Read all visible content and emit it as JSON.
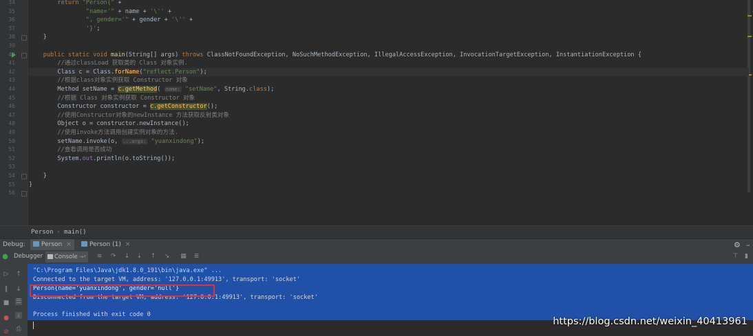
{
  "editor": {
    "lines": [
      {
        "no": "34",
        "html_tokens": [
          [
            "kw",
            "        return "
          ],
          [
            "str",
            "\"Person{\""
          ],
          [
            "cls",
            " +"
          ]
        ]
      },
      {
        "no": "35",
        "html_tokens": [
          [
            "str",
            "                \"name='\""
          ],
          [
            "cls",
            " + name + "
          ],
          [
            "str",
            "'\\''"
          ],
          [
            "cls",
            " +"
          ]
        ]
      },
      {
        "no": "36",
        "html_tokens": [
          [
            "str",
            "                \", gender='\""
          ],
          [
            "cls",
            " + gender + "
          ],
          [
            "str",
            "'\\''"
          ],
          [
            "cls",
            " +"
          ]
        ]
      },
      {
        "no": "37",
        "html_tokens": [
          [
            "str",
            "                '}'"
          ],
          [
            "cls",
            ";"
          ]
        ]
      },
      {
        "no": "38",
        "html_tokens": [
          [
            "cls",
            "    }"
          ]
        ]
      },
      {
        "no": "39",
        "html_tokens": []
      },
      {
        "no": "40",
        "html_tokens": [
          [
            "kw",
            "    public static void "
          ],
          [
            "fn",
            "main"
          ],
          [
            "cls",
            "(String[] args) "
          ],
          [
            "kw",
            "throws "
          ],
          [
            "cls",
            "ClassNotFoundException, NoSuchMethodException, IllegalAccessException, InvocationTargetException, InstantiationException {"
          ]
        ]
      },
      {
        "no": "41",
        "html_tokens": [
          [
            "cm",
            "        //通过classLoad 获取类的 Class 对象实例."
          ]
        ]
      },
      {
        "no": "42",
        "html_tokens": [
          [
            "cls",
            "        Class c = Class."
          ],
          [
            "fn",
            "forName"
          ],
          [
            "cls",
            "("
          ],
          [
            "str",
            "\"reflect.Person\""
          ],
          [
            "cls",
            ");"
          ]
        ]
      },
      {
        "no": "43",
        "html_tokens": [
          [
            "cm",
            "        //根据class对象实例获取 Constructor 对象"
          ]
        ]
      },
      {
        "no": "44",
        "html_tokens": [
          [
            "cls",
            "        Method setName = "
          ],
          [
            "sel",
            "c.getMethod"
          ],
          [
            "cls",
            "( "
          ],
          [
            "hint",
            "name:"
          ],
          [
            "str",
            " \"setName\""
          ],
          [
            "cls",
            ", String."
          ],
          [
            "kw",
            "class"
          ],
          [
            "cls",
            ");"
          ]
        ]
      },
      {
        "no": "45",
        "html_tokens": [
          [
            "cm",
            "        //根据 Class 对象实例获取 Constructor 对象"
          ]
        ]
      },
      {
        "no": "46",
        "html_tokens": [
          [
            "cls",
            "        Constructor constructor = "
          ],
          [
            "sel",
            "c.getConstructor"
          ],
          [
            "cls",
            "();"
          ]
        ]
      },
      {
        "no": "47",
        "html_tokens": [
          [
            "cm",
            "        //使用Constructor对象的newInstance 方法获取反射类对象"
          ]
        ]
      },
      {
        "no": "48",
        "html_tokens": [
          [
            "cls",
            "        Object o = constructor.newInstance();"
          ]
        ]
      },
      {
        "no": "49",
        "html_tokens": [
          [
            "cm",
            "        //使用invoke方法调用创建实例对象的方法."
          ]
        ]
      },
      {
        "no": "50",
        "html_tokens": [
          [
            "cls",
            "        setName.invoke(o, "
          ],
          [
            "hint",
            "...args:"
          ],
          [
            "str",
            " \"yuanxindong\""
          ],
          [
            "cls",
            ");"
          ]
        ]
      },
      {
        "no": "51",
        "html_tokens": [
          [
            "cm",
            "        //查看调用是否成功"
          ]
        ]
      },
      {
        "no": "52",
        "html_tokens": [
          [
            "cls",
            "        System."
          ],
          [
            "fld",
            "out"
          ],
          [
            "cls",
            ".println(o.toString());"
          ]
        ]
      },
      {
        "no": "53",
        "html_tokens": []
      },
      {
        "no": "54",
        "html_tokens": [
          [
            "cls",
            "    }"
          ]
        ]
      },
      {
        "no": "55",
        "html_tokens": [
          [
            "cls",
            "}"
          ]
        ]
      },
      {
        "no": "56",
        "html_tokens": []
      }
    ]
  },
  "breadcrumb": {
    "class": "Person",
    "separator": "›",
    "method": "main()"
  },
  "debug": {
    "label": "Debug:",
    "tabs": [
      {
        "label": "Person"
      },
      {
        "label": "Person (1)"
      }
    ],
    "close": "×"
  },
  "toolbar": {
    "debugger_tab": "Debugger",
    "console_tab": "Console",
    "console_arrow": "→*"
  },
  "console": {
    "lines": [
      "\"C:\\Program Files\\Java\\jdk1.8.0_191\\bin\\java.exe\" ...",
      "Connected to the target VM, address: '127.0.0.1:49913', transport: 'socket'",
      "Person{name='yuanxindong', gender='null'}",
      "Disconnected from the target VM, address: '127.0.0.1:49913', transport: 'socket'",
      "",
      "Process finished with exit code 0"
    ]
  },
  "watermark": "https://blog.csdn.net/weixin_40413961",
  "colors": {
    "console_bg": "#2150a8",
    "highlight_box": "#e53030",
    "editor_bg": "#2b2b2b"
  }
}
